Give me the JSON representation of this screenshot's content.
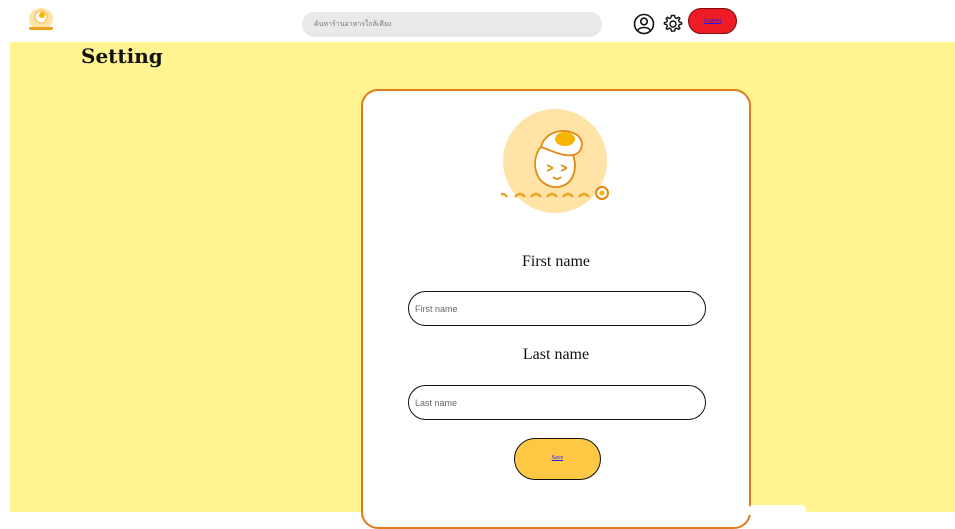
{
  "header": {
    "search": {
      "placeholder": "ค้นหาร้านอาหารใกล้เคียง",
      "value": ""
    },
    "user_icon": "user-circle-icon",
    "settings_icon": "gear-icon",
    "logout_label": "Logout"
  },
  "page": {
    "title": "Setting",
    "background": "#fff48f"
  },
  "form": {
    "logo_icon": "egg-mascot-logo",
    "first_name": {
      "label": "First name",
      "placeholder": "First name",
      "value": ""
    },
    "last_name": {
      "label": "Last name",
      "placeholder": "Last name",
      "value": ""
    },
    "save_label": "Save"
  },
  "colors": {
    "card_border": "#e07a1a",
    "logout_bg": "#ee1c24",
    "save_bg": "#ffc844",
    "logo_circle": "#ffe3a6",
    "egg_yolk": "#f7b500"
  }
}
